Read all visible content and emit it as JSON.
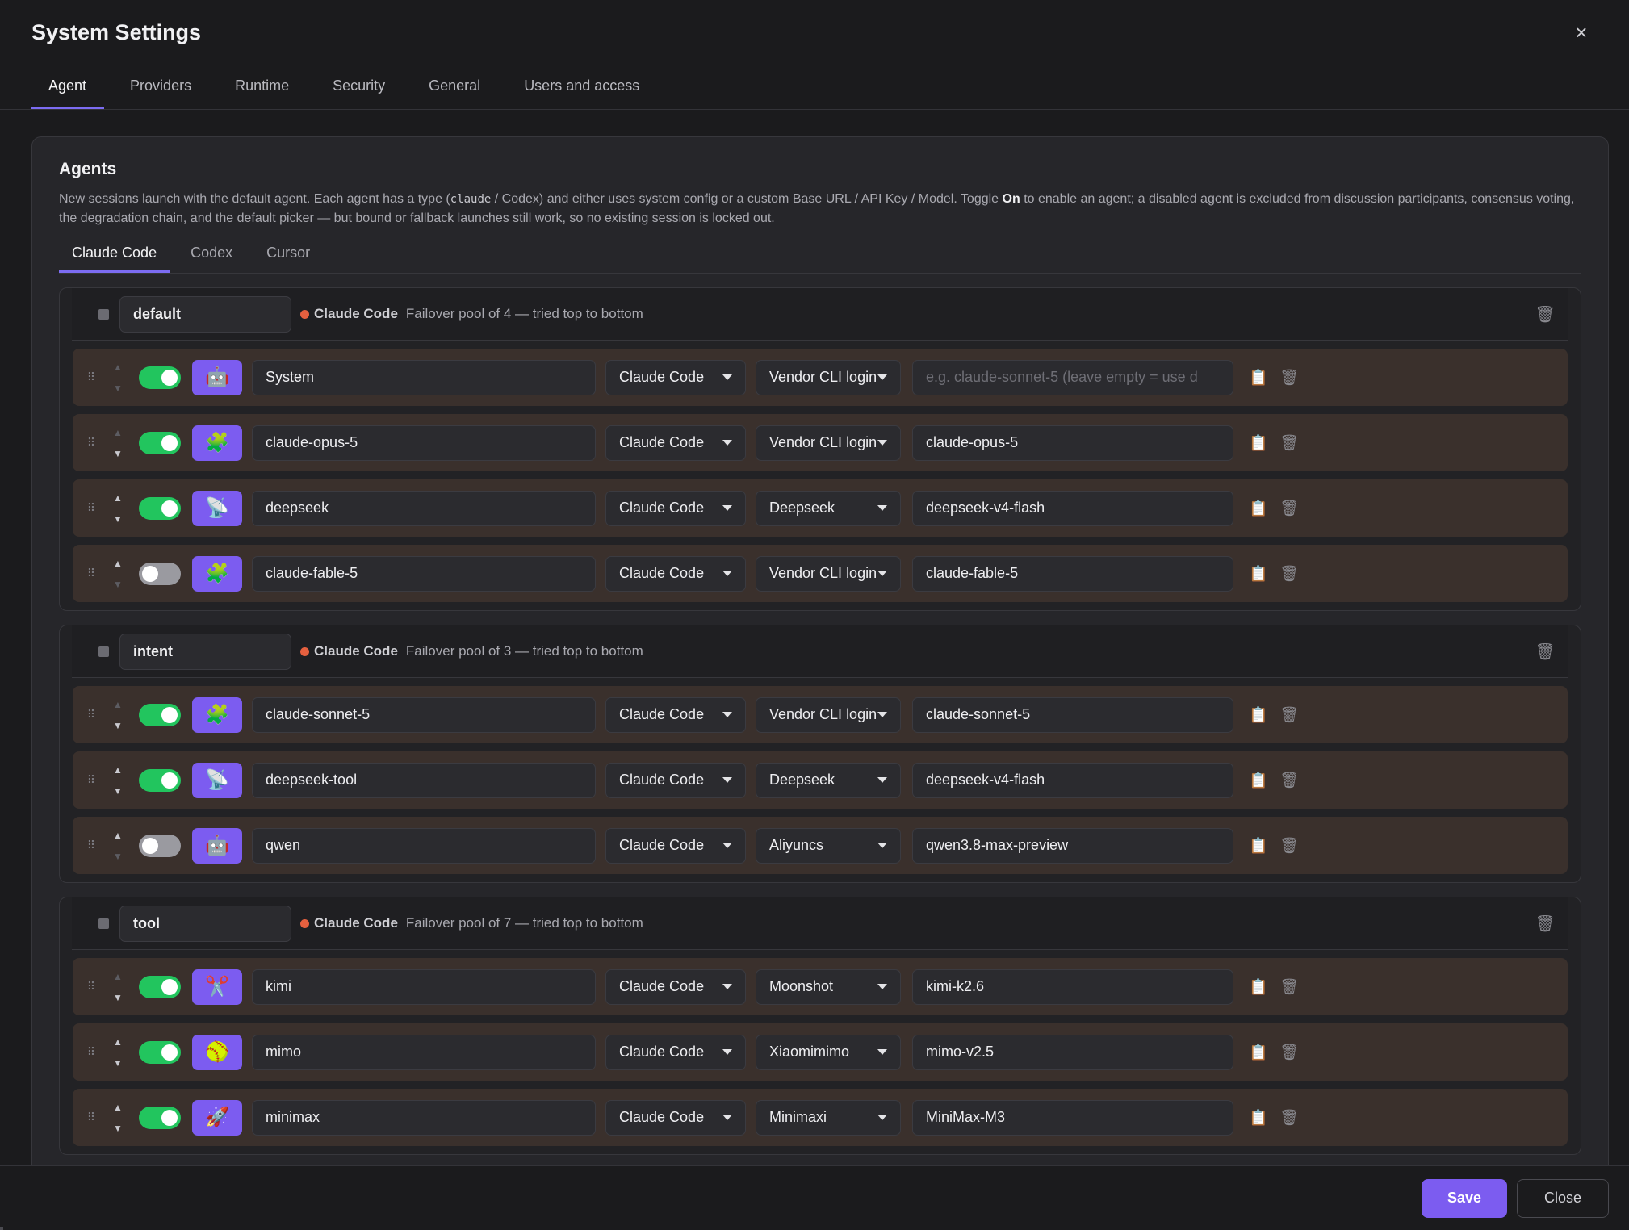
{
  "window": {
    "title": "System Settings",
    "close_icon": "×"
  },
  "tabs": [
    {
      "label": "Agent",
      "active": true
    },
    {
      "label": "Providers"
    },
    {
      "label": "Runtime"
    },
    {
      "label": "Security"
    },
    {
      "label": "General"
    },
    {
      "label": "Users and access"
    }
  ],
  "agents": {
    "title": "Agents",
    "desc_1": "New sessions launch with the default agent. Each agent has a type (",
    "desc_code": "claude",
    "desc_2": " / Codex) and either uses system config or a custom Base URL / API Key / Model. Toggle ",
    "desc_bold": "On",
    "desc_3": " to enable an agent; a disabled agent is excluded from discussion participants, consensus voting, the degradation chain, and the default picker — but bound or fallback launches still work, so no existing session is locked out.",
    "subtabs": [
      "Claude Code",
      "Codex",
      "Cursor"
    ]
  },
  "groups": [
    {
      "name": "default",
      "type": "Claude Code",
      "note": "Failover pool of 4 — tried top to bottom",
      "rows": [
        {
          "enabled": true,
          "avatar": "🤖",
          "avatar_icon": "robot-icon",
          "name": "System",
          "type": "Claude Code",
          "provider": "Vendor CLI login",
          "model": "",
          "model_placeholder": "e.g. claude-sonnet-5 (leave empty = use d",
          "up_enabled": false,
          "down_enabled": false
        },
        {
          "enabled": true,
          "avatar": "🧩",
          "avatar_icon": "puzzle-icon",
          "name": "claude-opus-5",
          "type": "Claude Code",
          "provider": "Vendor CLI login",
          "model": "claude-opus-5",
          "up_enabled": false,
          "down_enabled": true
        },
        {
          "enabled": true,
          "avatar": "📡",
          "avatar_icon": "satellite-icon",
          "name": "deepseek",
          "type": "Claude Code",
          "provider": "Deepseek",
          "model": "deepseek-v4-flash",
          "up_enabled": true,
          "down_enabled": true
        },
        {
          "enabled": false,
          "avatar": "🧩",
          "avatar_icon": "puzzle-icon",
          "name": "claude-fable-5",
          "type": "Claude Code",
          "provider": "Vendor CLI login",
          "model": "claude-fable-5",
          "up_enabled": true,
          "down_enabled": false
        }
      ]
    },
    {
      "name": "intent",
      "type": "Claude Code",
      "note": "Failover pool of 3 — tried top to bottom",
      "rows": [
        {
          "enabled": true,
          "avatar": "🧩",
          "avatar_icon": "puzzle-icon",
          "name": "claude-sonnet-5",
          "type": "Claude Code",
          "provider": "Vendor CLI login",
          "model": "claude-sonnet-5",
          "up_enabled": false,
          "down_enabled": true
        },
        {
          "enabled": true,
          "avatar": "📡",
          "avatar_icon": "satellite-icon",
          "name": "deepseek-tool",
          "type": "Claude Code",
          "provider": "Deepseek",
          "model": "deepseek-v4-flash",
          "up_enabled": true,
          "down_enabled": true
        },
        {
          "enabled": false,
          "avatar": "🤖",
          "avatar_icon": "robot-icon",
          "name": "qwen",
          "type": "Claude Code",
          "provider": "Aliyuncs",
          "model": "qwen3.8-max-preview",
          "up_enabled": true,
          "down_enabled": false
        }
      ]
    },
    {
      "name": "tool",
      "type": "Claude Code",
      "note": "Failover pool of 7 — tried top to bottom",
      "rows": [
        {
          "enabled": true,
          "avatar": "✂️",
          "avatar_icon": "scissors-icon",
          "name": "kimi",
          "type": "Claude Code",
          "provider": "Moonshot",
          "model": "kimi-k2.6",
          "up_enabled": false,
          "down_enabled": true
        },
        {
          "enabled": true,
          "avatar": "🥎",
          "avatar_icon": "ball-icon",
          "name": "mimo",
          "type": "Claude Code",
          "provider": "Xiaomimimo",
          "model": "mimo-v2.5",
          "up_enabled": true,
          "down_enabled": true
        },
        {
          "enabled": true,
          "avatar": "🚀",
          "avatar_icon": "rocket-icon",
          "name": "minimax",
          "type": "Claude Code",
          "provider": "Minimaxi",
          "model": "MiniMax-M3",
          "up_enabled": true,
          "down_enabled": true
        }
      ]
    }
  ],
  "icons": {
    "grip": "⠿",
    "up": "▲",
    "down": "▼",
    "copy": "📋",
    "trash": "🗑"
  },
  "colors": {
    "accent": "#7c5cf0",
    "toggle_on": "#22c55e",
    "type_dot": "#e5603f",
    "row_bg": "#3a302c"
  },
  "footer": {
    "save_label": "Save",
    "close_label": "Close"
  }
}
